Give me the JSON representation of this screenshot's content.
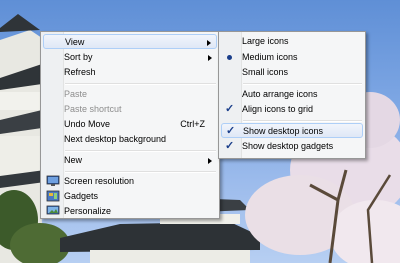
{
  "context_menu": {
    "items": [
      {
        "label": "View",
        "has_submenu": true,
        "state": "hover"
      },
      {
        "label": "Sort by",
        "has_submenu": true
      },
      {
        "label": "Refresh"
      },
      {
        "label": "Paste",
        "disabled": true
      },
      {
        "label": "Paste shortcut",
        "disabled": true
      },
      {
        "label": "Undo Move",
        "shortcut": "Ctrl+Z"
      },
      {
        "label": "Next desktop background"
      },
      {
        "label": "New",
        "has_submenu": true
      },
      {
        "label": "Screen resolution",
        "icon": "screen-resolution-icon"
      },
      {
        "label": "Gadgets",
        "icon": "gadgets-icon"
      },
      {
        "label": "Personalize",
        "icon": "personalize-icon"
      }
    ]
  },
  "view_submenu": {
    "items": [
      {
        "label": "Large icons"
      },
      {
        "label": "Medium icons",
        "selected": true
      },
      {
        "label": "Small icons"
      },
      {
        "label": "Auto arrange icons"
      },
      {
        "label": "Align icons to grid",
        "checked": true
      },
      {
        "label": "Show desktop icons",
        "checked": true,
        "state": "hover"
      },
      {
        "label": "Show desktop gadgets",
        "checked": true
      }
    ]
  },
  "colors": {
    "sky": "#7ea7e4",
    "menu_bg": "#f5f6f7",
    "hover_border": "#aecff7",
    "check": "#1a3e8a"
  }
}
